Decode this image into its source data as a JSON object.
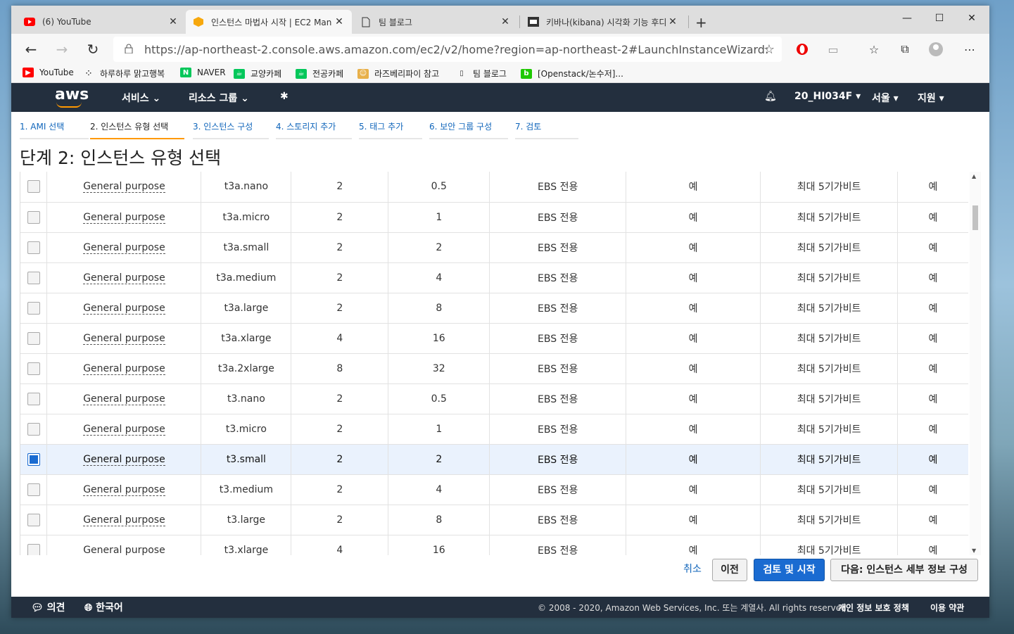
{
  "browser": {
    "tabs": [
      {
        "title": "(6) YouTube",
        "icon": "youtube-icon"
      },
      {
        "title": "인스턴스 마법사 시작 | EC2 Man",
        "icon": "aws-box-icon"
      },
      {
        "title": "팀 블로그",
        "icon": "page-icon"
      },
      {
        "title": "키바나(kibana) 시각화 기능 후디",
        "icon": "blog-icon"
      }
    ],
    "url": "https://ap-northeast-2.console.aws.amazon.com/ec2/v2/home?region=ap-northeast-2#LaunchInstanceWizard:",
    "bookmarks": [
      {
        "label": "YouTube",
        "icon": "youtube-icon"
      },
      {
        "label": "하루하루 맑고행복",
        "icon": "dots-icon"
      },
      {
        "label": "NAVER",
        "icon": "naver-icon"
      },
      {
        "label": "교양카페",
        "icon": "cafe-icon"
      },
      {
        "label": "전공카페",
        "icon": "cafe-icon"
      },
      {
        "label": "라즈베리파이 참고",
        "icon": "avatar-icon"
      },
      {
        "label": "팀 블로그",
        "icon": "page-icon"
      },
      {
        "label": "[Openstack/논수저]...",
        "icon": "blog-icon"
      }
    ]
  },
  "aws_nav": {
    "logo": "aws",
    "services": "서비스",
    "resource_groups": "리소스 그룹",
    "account": "20_HI034F",
    "region": "서울",
    "support": "지원"
  },
  "steps": [
    "1. AMI 선택",
    "2. 인스턴스 유형 선택",
    "3. 인스턴스 구성",
    "4. 스토리지 추가",
    "5. 태그 추가",
    "6. 보안 그룹 구성",
    "7. 검토"
  ],
  "page_title": "단계 2: 인스턴스 유형 선택",
  "table": {
    "rows": [
      {
        "family": "General purpose",
        "type": "t3a.nano",
        "vcpus": "2",
        "memory": "0.5",
        "storage": "EBS 전용",
        "ebs_opt": "예",
        "network": "최대 5기가비트",
        "ipv6": "예",
        "selected": false
      },
      {
        "family": "General purpose",
        "type": "t3a.micro",
        "vcpus": "2",
        "memory": "1",
        "storage": "EBS 전용",
        "ebs_opt": "예",
        "network": "최대 5기가비트",
        "ipv6": "예",
        "selected": false
      },
      {
        "family": "General purpose",
        "type": "t3a.small",
        "vcpus": "2",
        "memory": "2",
        "storage": "EBS 전용",
        "ebs_opt": "예",
        "network": "최대 5기가비트",
        "ipv6": "예",
        "selected": false
      },
      {
        "family": "General purpose",
        "type": "t3a.medium",
        "vcpus": "2",
        "memory": "4",
        "storage": "EBS 전용",
        "ebs_opt": "예",
        "network": "최대 5기가비트",
        "ipv6": "예",
        "selected": false
      },
      {
        "family": "General purpose",
        "type": "t3a.large",
        "vcpus": "2",
        "memory": "8",
        "storage": "EBS 전용",
        "ebs_opt": "예",
        "network": "최대 5기가비트",
        "ipv6": "예",
        "selected": false
      },
      {
        "family": "General purpose",
        "type": "t3a.xlarge",
        "vcpus": "4",
        "memory": "16",
        "storage": "EBS 전용",
        "ebs_opt": "예",
        "network": "최대 5기가비트",
        "ipv6": "예",
        "selected": false
      },
      {
        "family": "General purpose",
        "type": "t3a.2xlarge",
        "vcpus": "8",
        "memory": "32",
        "storage": "EBS 전용",
        "ebs_opt": "예",
        "network": "최대 5기가비트",
        "ipv6": "예",
        "selected": false
      },
      {
        "family": "General purpose",
        "type": "t3.nano",
        "vcpus": "2",
        "memory": "0.5",
        "storage": "EBS 전용",
        "ebs_opt": "예",
        "network": "최대 5기가비트",
        "ipv6": "예",
        "selected": false
      },
      {
        "family": "General purpose",
        "type": "t3.micro",
        "vcpus": "2",
        "memory": "1",
        "storage": "EBS 전용",
        "ebs_opt": "예",
        "network": "최대 5기가비트",
        "ipv6": "예",
        "selected": false
      },
      {
        "family": "General purpose",
        "type": "t3.small",
        "vcpus": "2",
        "memory": "2",
        "storage": "EBS 전용",
        "ebs_opt": "예",
        "network": "최대 5기가비트",
        "ipv6": "예",
        "selected": true
      },
      {
        "family": "General purpose",
        "type": "t3.medium",
        "vcpus": "2",
        "memory": "4",
        "storage": "EBS 전용",
        "ebs_opt": "예",
        "network": "최대 5기가비트",
        "ipv6": "예",
        "selected": false
      },
      {
        "family": "General purpose",
        "type": "t3.large",
        "vcpus": "2",
        "memory": "8",
        "storage": "EBS 전용",
        "ebs_opt": "예",
        "network": "최대 5기가비트",
        "ipv6": "예",
        "selected": false
      },
      {
        "family": "General purpose",
        "type": "t3.xlarge",
        "vcpus": "4",
        "memory": "16",
        "storage": "EBS 전용",
        "ebs_opt": "예",
        "network": "최대 5기가비트",
        "ipv6": "예",
        "selected": false
      }
    ]
  },
  "actions": {
    "cancel": "취소",
    "previous": "이전",
    "review_launch": "검토 및 시작",
    "next": "다음: 인스턴스 세부 정보 구성"
  },
  "footer": {
    "feedback": "의견",
    "language": "한국어",
    "copyright": "© 2008 - 2020, Amazon Web Services, Inc. 또는 계열사. All rights reserved.",
    "privacy": "개인 정보 보호 정책",
    "terms": "이용 약관"
  },
  "colors": {
    "aws_nav": "#232f3e",
    "accent_orange": "#ff9900",
    "primary_blue": "#1a6bd1",
    "link_blue": "#1166bb"
  }
}
